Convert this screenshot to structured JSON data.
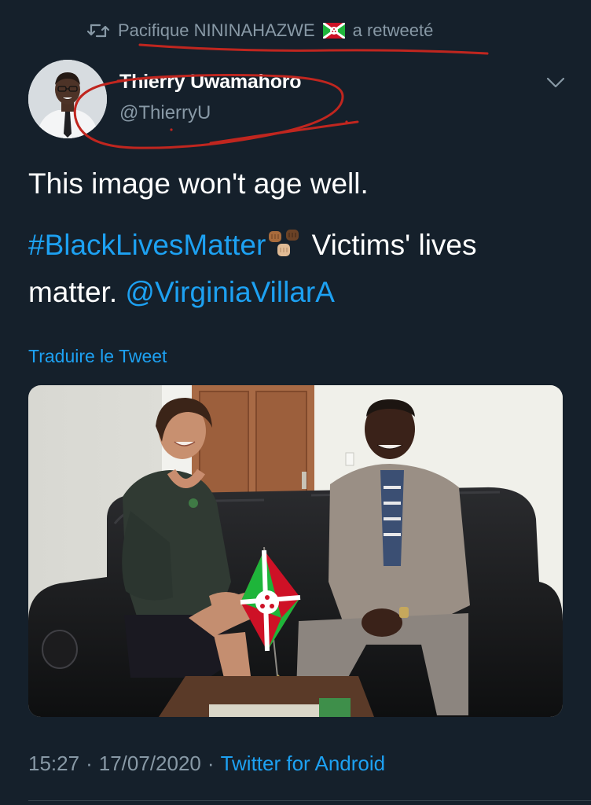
{
  "retweet": {
    "user": "Pacifique NININAHAZWE",
    "action": "a retweeté",
    "icon": "retweet-icon",
    "flag": "burundi-flag-emoji"
  },
  "author": {
    "name": "Thierry Uwamahoro",
    "handle": "@ThierryU",
    "avatar_icon": "avatar-photo"
  },
  "tweet": {
    "line1": "This image won't age well.",
    "hashtag": "#BlackLivesMatter",
    "emoji": "raised-fists-emoji",
    "text_after_hashtag": " Victims' lives",
    "text_matter": "matter. ",
    "mention": "@VirginiaVillarA"
  },
  "translate_label": "Traduire le Tweet",
  "meta": {
    "time": "15:27",
    "sep1": "·",
    "date": "17/07/2020",
    "sep2": "·",
    "source": "Twitter for Android"
  },
  "colors": {
    "background": "#15202b",
    "accent": "#1da1f2",
    "secondary_text": "#8899a6",
    "annotation_red": "#c0261f"
  }
}
